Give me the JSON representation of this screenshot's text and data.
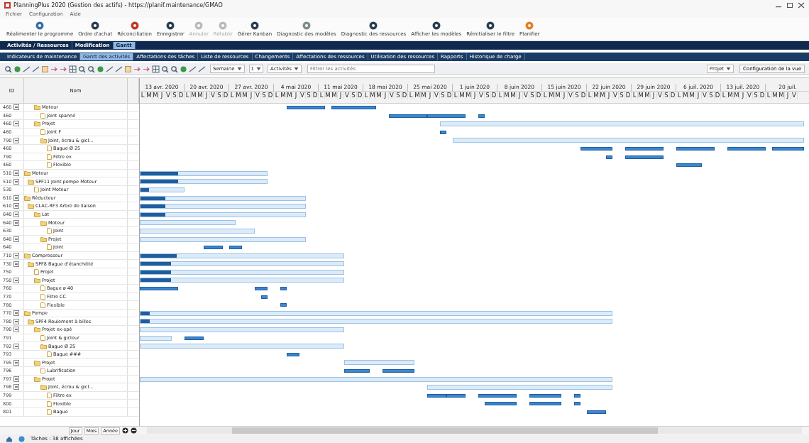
{
  "window": {
    "title": "PlanningPlus 2020 (Gestion des actifs) - https://planif.maintenance/GMAO"
  },
  "menu": [
    "Fichier",
    "Configuration",
    "Aide"
  ],
  "ribbon": [
    {
      "label": "Réalimenter le programme",
      "disabled": false
    },
    {
      "label": "Ordre d'achat",
      "disabled": false
    },
    {
      "label": "Réconciliation",
      "disabled": false
    },
    {
      "label": "Enregistrer",
      "disabled": false
    },
    {
      "label": "Annuler",
      "disabled": true
    },
    {
      "label": "Rétablir",
      "disabled": true
    },
    {
      "label": "Gérer Kanban",
      "disabled": false
    },
    {
      "label": "Diagnostic des modèles",
      "disabled": false
    },
    {
      "label": "Diagnostic des ressources",
      "disabled": false
    },
    {
      "label": "Afficher les modèles",
      "disabled": false
    },
    {
      "label": "Réinitialiser le filtre",
      "disabled": false
    },
    {
      "label": "Planifier",
      "disabled": false
    }
  ],
  "tabs": [
    {
      "label": "Activités / Ressources",
      "selected": false
    },
    {
      "label": "Modification",
      "selected": false
    },
    {
      "label": "Gantt",
      "selected": true
    }
  ],
  "subtabs": [
    {
      "label": "Indicateurs de maintenance",
      "selected": false
    },
    {
      "label": "Gantt des activités",
      "selected": true
    },
    {
      "label": "Affectations des tâches",
      "selected": false
    },
    {
      "label": "Liste de ressources",
      "selected": false
    },
    {
      "label": "Changements",
      "selected": false
    },
    {
      "label": "Affectations des ressources",
      "selected": false
    },
    {
      "label": "Utilisation des ressources",
      "selected": false
    },
    {
      "label": "Rapports",
      "selected": false
    },
    {
      "label": "Historique de charge",
      "selected": false
    }
  ],
  "toolbar": {
    "scale": "Semaine",
    "step": "1",
    "view": "Activités",
    "search": {
      "placeholder": "Filtrer les activités"
    },
    "project": "Projet",
    "config": "Configuration de la vue"
  },
  "grid": {
    "columns": [
      "ID",
      "Nom"
    ]
  },
  "timeline": {
    "weeks": [
      {
        "label": "13 avr. 2020",
        "days": [
          "L",
          "M",
          "M",
          "J",
          "V",
          "S",
          "D"
        ]
      },
      {
        "label": "20 avr. 2020",
        "days": [
          "L",
          "M",
          "M",
          "J",
          "V",
          "S",
          "D"
        ]
      },
      {
        "label": "27 avr. 2020",
        "days": [
          "L",
          "M",
          "M",
          "J",
          "V",
          "S",
          "D"
        ]
      },
      {
        "label": "4 mai 2020",
        "days": [
          "L",
          "M",
          "M",
          "J",
          "V",
          "S",
          "D"
        ]
      },
      {
        "label": "11 mai 2020",
        "days": [
          "L",
          "M",
          "M",
          "J",
          "V",
          "S",
          "D"
        ]
      },
      {
        "label": "18 mai 2020",
        "days": [
          "L",
          "M",
          "M",
          "J",
          "V",
          "S",
          "D"
        ]
      },
      {
        "label": "25 mai 2020",
        "days": [
          "L",
          "M",
          "M",
          "J",
          "V",
          "S",
          "D"
        ]
      },
      {
        "label": "1 juin 2020",
        "days": [
          "L",
          "M",
          "M",
          "J",
          "V",
          "S",
          "D"
        ]
      },
      {
        "label": "8 juin 2020",
        "days": [
          "L",
          "M",
          "M",
          "J",
          "V",
          "S",
          "D"
        ]
      },
      {
        "label": "15 juin 2020",
        "days": [
          "L",
          "M",
          "M",
          "J",
          "V",
          "S",
          "D"
        ]
      },
      {
        "label": "22 juin 2020",
        "days": [
          "L",
          "M",
          "M",
          "J",
          "V",
          "S",
          "D"
        ]
      },
      {
        "label": "29 juin 2020",
        "days": [
          "L",
          "M",
          "M",
          "J",
          "V",
          "S",
          "D"
        ]
      },
      {
        "label": "6 juil. 2020",
        "days": [
          "L",
          "M",
          "M",
          "J",
          "V",
          "S",
          "D"
        ]
      },
      {
        "label": "13 juil. 2020",
        "days": [
          "L",
          "M",
          "M",
          "J",
          "V",
          "S",
          "D"
        ]
      },
      {
        "label": "20 juil.",
        "days": [
          "L",
          "M",
          "M",
          "J",
          "V"
        ]
      }
    ]
  },
  "tree": [
    {
      "children": [
        {
          "children": [
            {
              "id": "460",
              "name": "Moteur",
              "expanded": true,
              "children": [
                {
                  "id": "460",
                  "name": "Joint spanné"
                }
              ]
            },
            {
              "id": "460",
              "name": "Projet",
              "expanded": true,
              "children": [
                {
                  "id": "460",
                  "name": "Joint F"
                },
                {
                  "id": "790",
                  "name": "Joint, écrou & gicl...",
                  "expanded": true,
                  "children": [
                    {
                      "id": "460",
                      "name": "Bague Ø 25"
                    },
                    {
                      "id": "790",
                      "name": "Filtre ex"
                    },
                    {
                      "id": "460",
                      "name": "Flexible"
                    }
                  ]
                }
              ]
            }
          ]
        }
      ]
    },
    {
      "id": "510",
      "name": "Moteur",
      "expanded": true,
      "children": [
        {
          "id": "510",
          "name": "SPF11 Joint pompe Moteur",
          "expanded": true,
          "children": [
            {
              "id": "530",
              "name": "Joint Moteur"
            }
          ]
        }
      ]
    },
    {
      "id": "610",
      "name": "Réducteur",
      "expanded": true,
      "children": [
        {
          "id": "610",
          "name": "CLAC-RF3 Arbre de liaison",
          "expanded": true,
          "children": [
            {
              "id": "640",
              "name": "Lot",
              "expanded": true,
              "children": [
                {
                  "id": "640",
                  "name": "Moteur",
                  "expanded": true,
                  "children": [
                    {
                      "id": "630",
                      "name": "Joint"
                    }
                  ]
                },
                {
                  "id": "640",
                  "name": "Projet",
                  "expanded": true,
                  "children": [
                    {
                      "id": "640",
                      "name": "Joint"
                    }
                  ]
                }
              ]
            }
          ]
        }
      ]
    },
    {
      "id": "710",
      "name": "Compresseur",
      "expanded": true,
      "children": [
        {
          "id": "730",
          "name": "SPF8 Bague d'étanchéité",
          "expanded": true,
          "children": [
            {
              "id": "750",
              "name": "Projet"
            },
            {
              "id": "750",
              "name": "Projet",
              "expanded": true,
              "children": [
                {
                  "id": "760",
                  "name": "Bague ø 40"
                },
                {
                  "id": "770",
                  "name": "Filtre CC"
                },
                {
                  "id": "780",
                  "name": "Flexible"
                }
              ]
            }
          ]
        }
      ]
    },
    {
      "id": "770",
      "name": "Pompe",
      "expanded": true,
      "children": [
        {
          "id": "780",
          "name": "SPF4 Roulement à billes",
          "expanded": true,
          "children": [
            {
              "id": "790",
              "name": "Projet ex-spé",
              "expanded": true,
              "children": [
                {
                  "id": "791",
                  "name": "Joint & gicleur"
                },
                {
                  "id": "792",
                  "name": "Bague Ø 25",
                  "expanded": true,
                  "children": [
                    {
                      "id": "793",
                      "name": "Bague ###"
                    }
                  ]
                }
              ]
            },
            {
              "id": "795",
              "name": "Projet",
              "expanded": true,
              "children": [
                {
                  "id": "796",
                  "name": "Lubrification"
                }
              ]
            },
            {
              "id": "797",
              "name": "Projet",
              "expanded": true,
              "children": [
                {
                  "id": "798",
                  "name": "Joint, écrou & gicl...",
                  "expanded": true,
                  "children": [
                    {
                      "id": "799",
                      "name": "Filtre ex"
                    },
                    {
                      "id": "800",
                      "name": "Flexible"
                    },
                    {
                      "id": "801",
                      "name": "Bague"
                    }
                  ]
                }
              ]
            }
          ]
        }
      ]
    }
  ],
  "scale_buttons": [
    "Jour",
    "Mois",
    "Année"
  ],
  "status": "Tâches : 38 affichées"
}
